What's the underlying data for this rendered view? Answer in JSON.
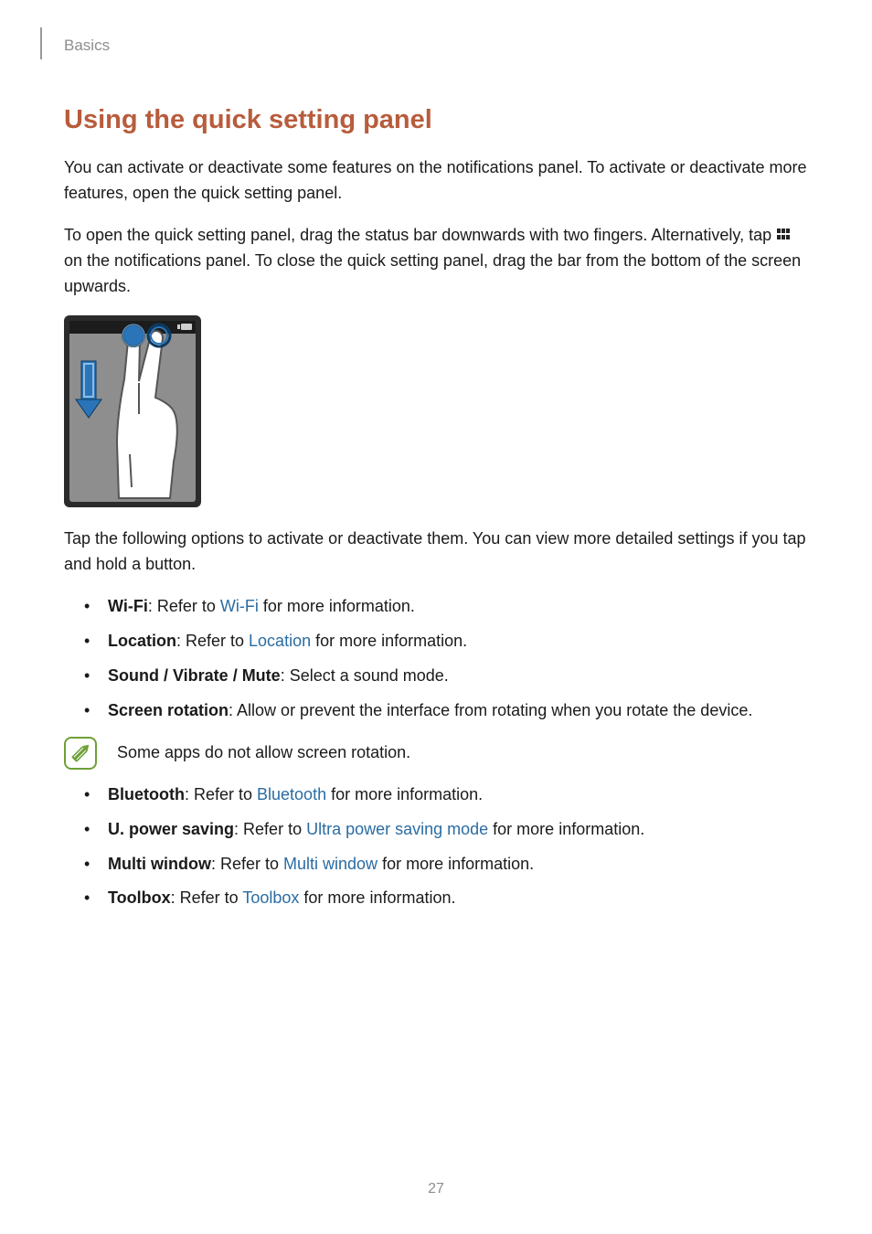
{
  "header": {
    "breadcrumb": "Basics"
  },
  "section": {
    "title": "Using the quick setting panel"
  },
  "paragraphs": {
    "p1": "You can activate or deactivate some features on the notifications panel. To activate or deactivate more features, open the quick setting panel.",
    "p2a": "To open the quick setting panel, drag the status bar downwards with two fingers. Alternatively, tap ",
    "p2b": " on the notifications panel. To close the quick setting panel, drag the bar from the bottom of the screen upwards.",
    "p3": "Tap the following options to activate or deactivate them. You can view more detailed settings if you tap and hold a button."
  },
  "options": [
    {
      "label": "Wi-Fi",
      "text_a": ": Refer to ",
      "xref": "Wi-Fi",
      "text_b": " for more information."
    },
    {
      "label": "Location",
      "text_a": ": Refer to ",
      "xref": "Location",
      "text_b": " for more information."
    },
    {
      "label": "Sound / Vibrate / Mute",
      "text_a": ": Select a sound mode.",
      "xref": "",
      "text_b": ""
    },
    {
      "label": "Screen rotation",
      "text_a": ": Allow or prevent the interface from rotating when you rotate the device.",
      "xref": "",
      "text_b": ""
    }
  ],
  "note": {
    "text": "Some apps do not allow screen rotation."
  },
  "options2": [
    {
      "label": "Bluetooth",
      "text_a": ": Refer to ",
      "xref": "Bluetooth",
      "text_b": " for more information."
    },
    {
      "label": "U. power saving",
      "text_a": ": Refer to ",
      "xref": "Ultra power saving mode",
      "text_b": " for more information."
    },
    {
      "label": "Multi window",
      "text_a": ": Refer to ",
      "xref": "Multi window",
      "text_b": " for more information."
    },
    {
      "label": "Toolbox",
      "text_a": ": Refer to ",
      "xref": "Toolbox",
      "text_b": " for more information."
    }
  ],
  "page_number": "27",
  "icons": {
    "grid_icon": "grid-icon",
    "note_icon": "note-pencil-icon"
  },
  "colors": {
    "heading": "#b85c3c",
    "link": "#2a6ca3",
    "muted": "#8d8d8d"
  }
}
